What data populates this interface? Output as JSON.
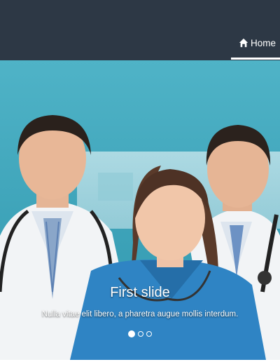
{
  "navbar": {
    "home_label": "Home",
    "home_icon": "home-icon",
    "background": "#2d3845"
  },
  "carousel": {
    "slide_title": "First slide",
    "slide_text": "Nulla vitae elit libero, a pharetra augue mollis interdum.",
    "indicators": 3,
    "active_index": 0
  }
}
